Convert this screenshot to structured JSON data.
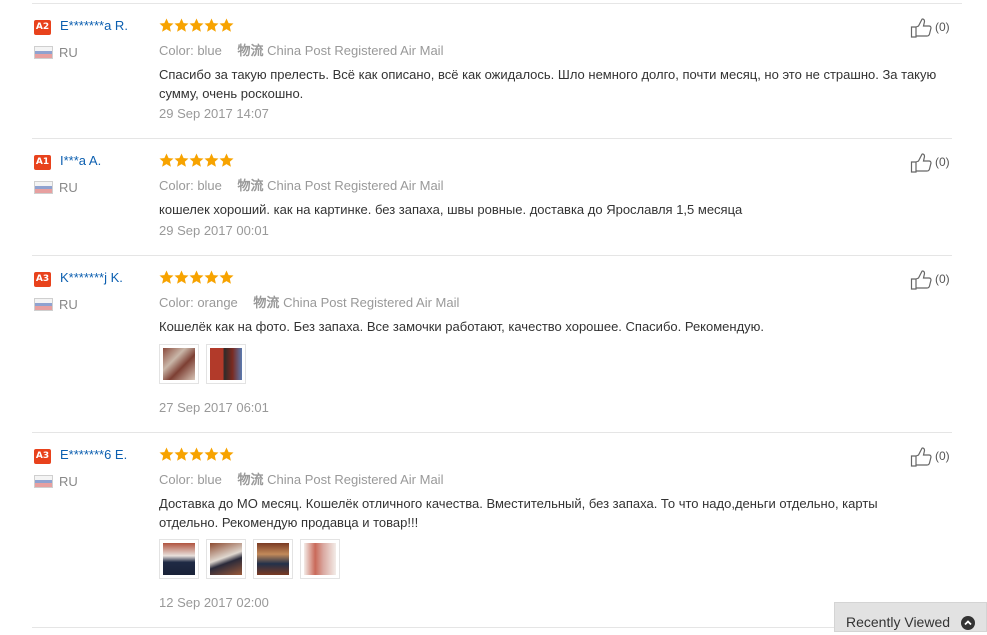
{
  "reviews": [
    {
      "badge": "A2",
      "name": "E*******a R.",
      "country": "RU",
      "color_label": "Color:",
      "color": "blue",
      "logistics_label": "物流",
      "logistics": "China Post Registered Air Mail",
      "text": "Спасибо за такую прелесть. Всё как описано, всё как ожидалось. Шло немного долго, почти месяц, но это не страшно. За такую сумму, очень роскошно.",
      "date": "29 Sep 2017 14:07",
      "likes": "(0)",
      "stars": 5
    },
    {
      "badge": "A1",
      "name": "I***a A.",
      "country": "RU",
      "color_label": "Color:",
      "color": "blue",
      "logistics_label": "物流",
      "logistics": "China Post Registered Air Mail",
      "text": "кошелек хороший. как на картинке. без запаха, швы ровные. доставка до Ярославля 1,5 месяца",
      "date": "29 Sep 2017 00:01",
      "likes": "(0)",
      "stars": 5
    },
    {
      "badge": "A3",
      "name": "K*******j K.",
      "country": "RU",
      "color_label": "Color:",
      "color": "orange",
      "logistics_label": "物流",
      "logistics": "China Post Registered Air Mail",
      "text": "Кошелёк как на фото. Без запаха. Все замочки работают, качество хорошее. Спасибо. Рекомендую.",
      "date": "27 Sep 2017 06:01",
      "likes": "(0)",
      "stars": 5
    },
    {
      "badge": "A3",
      "name": "E*******6 E.",
      "country": "RU",
      "color_label": "Color:",
      "color": "blue",
      "logistics_label": "物流",
      "logistics": "China Post Registered Air Mail",
      "text": "Доставка до МО месяц. Кошелёк отличного качества. Вместительный, без запаха. То что надо,деньги отдельно, карты отдельно. Рекомендую продавца и товар!!!",
      "date": "12 Sep 2017 02:00",
      "likes": "(0)",
      "stars": 5
    }
  ],
  "recently_viewed": {
    "label": "Recently Viewed"
  },
  "colors": {
    "badge": "#e8421c",
    "name": "#0c5fb0",
    "star": "#f7a300"
  }
}
